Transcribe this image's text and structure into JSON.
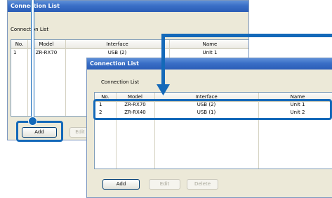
{
  "back_window": {
    "title": "Connection List",
    "group_label": "Connection List",
    "columns": [
      "No.",
      "Model",
      "Interface",
      "Name"
    ],
    "rows": [
      {
        "no": "1",
        "model": "ZR-RX70",
        "interface": "USB (2)",
        "name": "Unit 1"
      }
    ],
    "buttons": {
      "add": "Add",
      "edit": "Edit"
    }
  },
  "front_window": {
    "title": "Connection List",
    "group_label": "Connection List",
    "columns": [
      "No.",
      "Model",
      "Interface",
      "Name"
    ],
    "rows": [
      {
        "no": "1",
        "model": "ZR-RX70",
        "interface": "USB (2)",
        "name": "Unit 1"
      },
      {
        "no": "2",
        "model": "ZR-RX40",
        "interface": "USB (1)",
        "name": "Unit 2"
      }
    ],
    "buttons": {
      "add": "Add",
      "edit": "Edit",
      "delete": "Delete"
    }
  },
  "colors": {
    "callout": "#1469b9",
    "titlebar": "#3a6fc7"
  }
}
